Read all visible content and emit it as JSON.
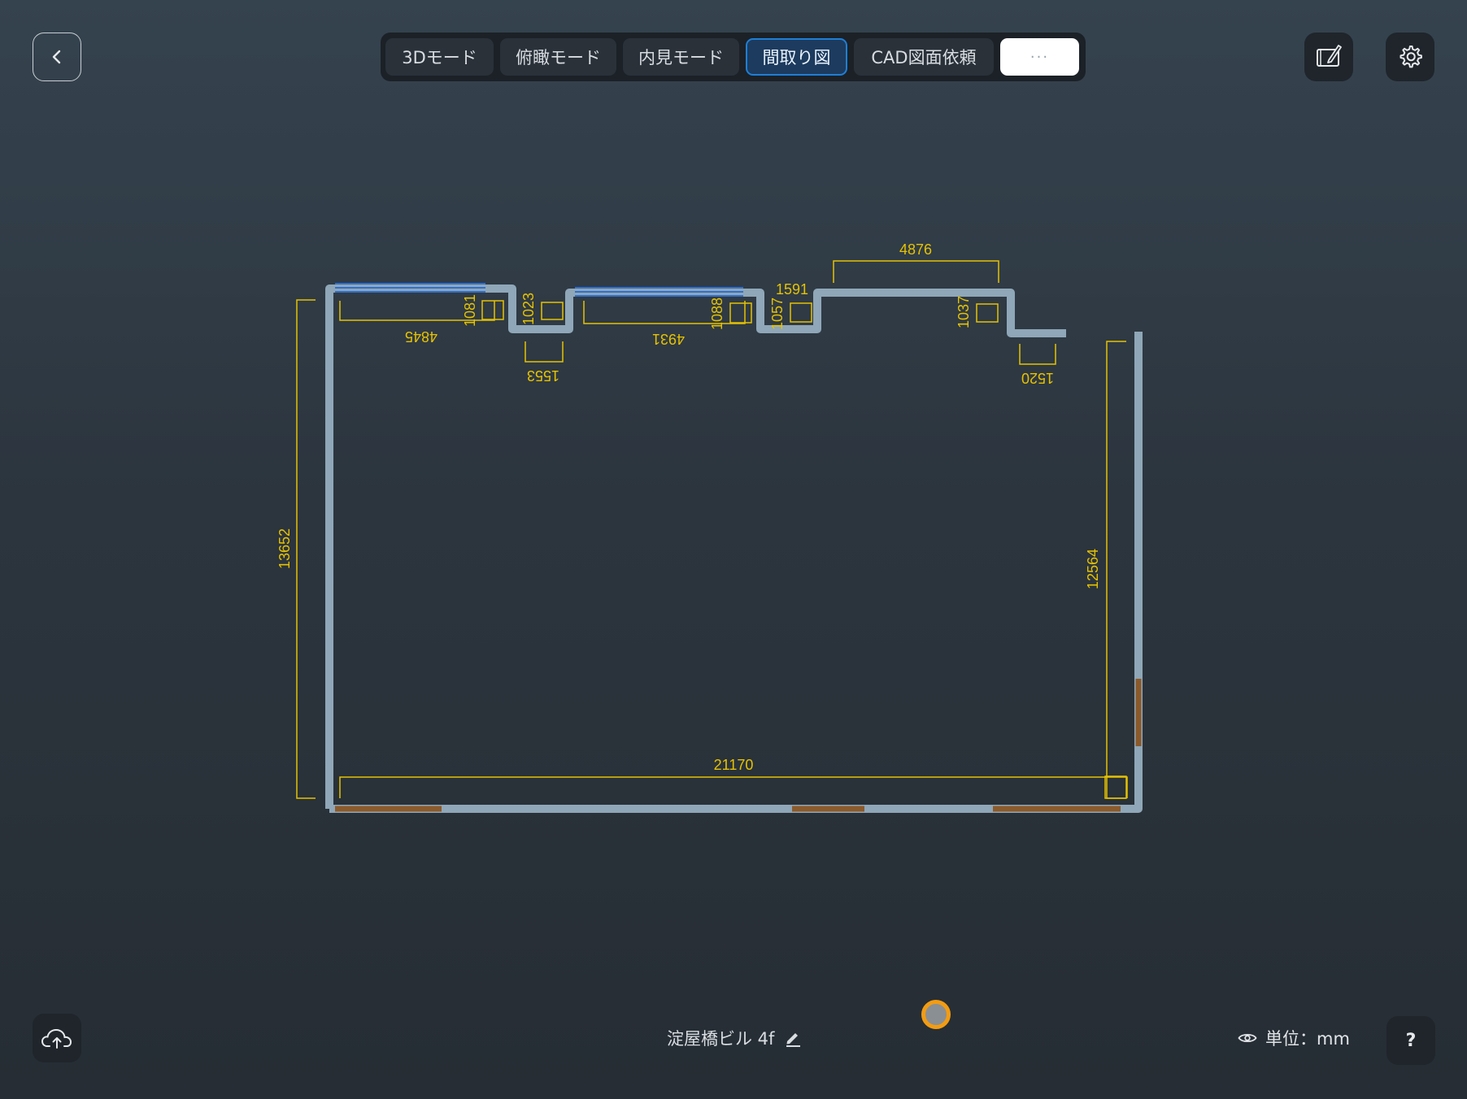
{
  "modes": [
    {
      "label": "3Dモード",
      "active": false
    },
    {
      "label": "俯瞰モード",
      "active": false
    },
    {
      "label": "内見モード",
      "active": false
    },
    {
      "label": "間取り図",
      "active": true
    },
    {
      "label": "CAD図面依頼",
      "active": false
    },
    {
      "label": "···",
      "active": false
    }
  ],
  "floor_plan": {
    "dimensions": {
      "top_width": "4876",
      "notch_width": "1591",
      "window1_width": "4845",
      "window2_width": "4931",
      "step1_depth": "1081",
      "step2_depth": "1023",
      "step3_depth": "1088",
      "step4_depth": "1057",
      "step5_depth": "1037",
      "notch1_width": "1553",
      "notch2_width": "1520",
      "left_height": "13652",
      "right_height": "12564",
      "total_width": "21170"
    },
    "colors": {
      "wall": "#8fa7b8",
      "window": "#2f6fd0",
      "door": "#8b5a2b",
      "dimension": "#e6c200"
    }
  },
  "footer": {
    "property_name": "淀屋橋ビル 4f",
    "unit_label": "単位：mm"
  },
  "icons": {
    "back": "chevron-left-icon",
    "edit": "tablet-pen-icon",
    "settings": "gear-icon",
    "upload": "cloud-upload-icon",
    "help": "?",
    "visibility": "eye-icon",
    "rename": "pencil-icon"
  }
}
